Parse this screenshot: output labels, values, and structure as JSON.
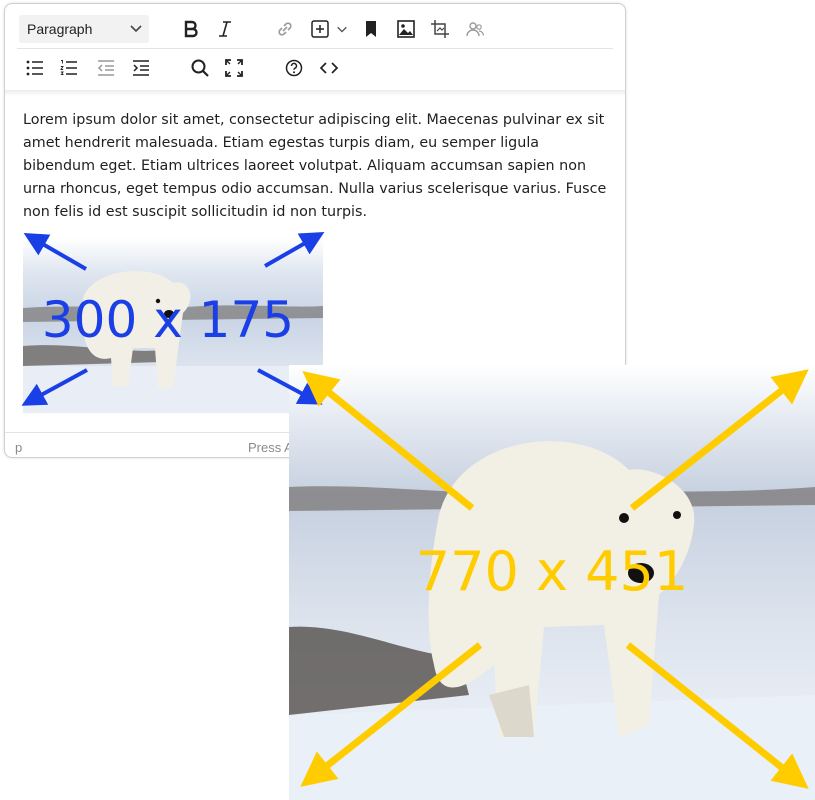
{
  "toolbar": {
    "block_format": "Paragraph",
    "icons_row1": [
      "bold-icon",
      "italic-icon",
      "link-icon",
      "insert-icon",
      "bookmark-icon",
      "image-icon",
      "crop-icon",
      "users-icon"
    ],
    "icons_row2": [
      "bullet-list-icon",
      "numbered-list-icon",
      "outdent-icon",
      "indent-icon",
      "search-icon",
      "fullscreen-icon",
      "help-icon",
      "source-code-icon"
    ]
  },
  "content": {
    "paragraph": "Lorem ipsum dolor sit amet, consectetur adipiscing elit. Maecenas pulvinar ex sit amet hendrerit malesuada. Etiam egestas turpis diam, eu semper ligula bibendum eget. Etiam ultrices laoreet volutpat. Aliquam accumsan sapien non urna rhoncus, eget tempus odio accumsan. Nulla varius scelerisque varius. Fusce non felis id est suscipit sollicitudin id non turpis."
  },
  "statusbar": {
    "path": "p",
    "hint": "Press A"
  },
  "annotations": {
    "small_dims": "300 x 175",
    "big_dims": "770 x 451",
    "small_color": "#1a3fe6",
    "big_color": "#ffcc00"
  }
}
